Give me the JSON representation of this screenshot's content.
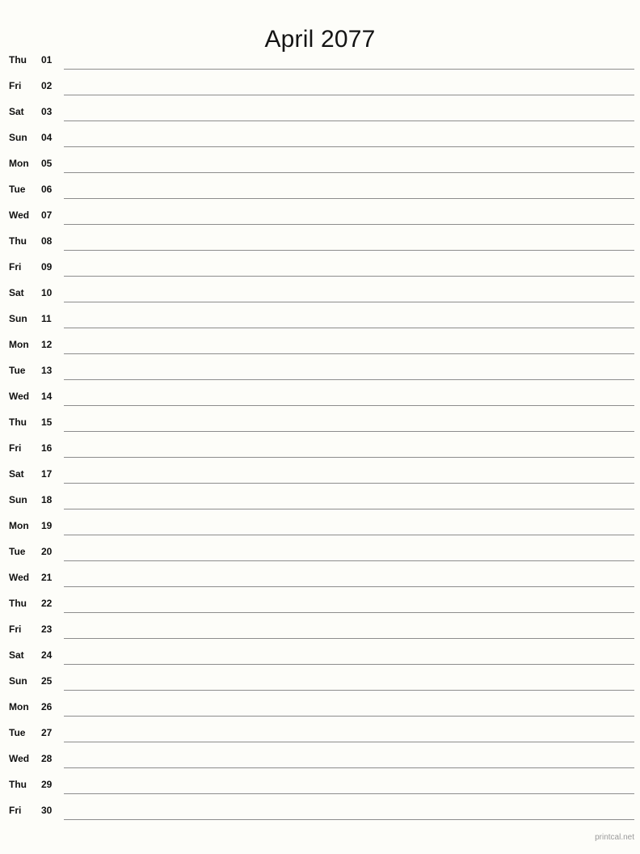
{
  "document": {
    "title": "April 2077",
    "month": "April",
    "year": "2077",
    "layout": "notes-list",
    "paper_background": "#fdfdf9",
    "line_color": "#8d8d8d",
    "text_color": "#141414"
  },
  "footer": {
    "label": "printcal.net"
  },
  "days": [
    {
      "weekday": "Thu",
      "date": "01"
    },
    {
      "weekday": "Fri",
      "date": "02"
    },
    {
      "weekday": "Sat",
      "date": "03"
    },
    {
      "weekday": "Sun",
      "date": "04"
    },
    {
      "weekday": "Mon",
      "date": "05"
    },
    {
      "weekday": "Tue",
      "date": "06"
    },
    {
      "weekday": "Wed",
      "date": "07"
    },
    {
      "weekday": "Thu",
      "date": "08"
    },
    {
      "weekday": "Fri",
      "date": "09"
    },
    {
      "weekday": "Sat",
      "date": "10"
    },
    {
      "weekday": "Sun",
      "date": "11"
    },
    {
      "weekday": "Mon",
      "date": "12"
    },
    {
      "weekday": "Tue",
      "date": "13"
    },
    {
      "weekday": "Wed",
      "date": "14"
    },
    {
      "weekday": "Thu",
      "date": "15"
    },
    {
      "weekday": "Fri",
      "date": "16"
    },
    {
      "weekday": "Sat",
      "date": "17"
    },
    {
      "weekday": "Sun",
      "date": "18"
    },
    {
      "weekday": "Mon",
      "date": "19"
    },
    {
      "weekday": "Tue",
      "date": "20"
    },
    {
      "weekday": "Wed",
      "date": "21"
    },
    {
      "weekday": "Thu",
      "date": "22"
    },
    {
      "weekday": "Fri",
      "date": "23"
    },
    {
      "weekday": "Sat",
      "date": "24"
    },
    {
      "weekday": "Sun",
      "date": "25"
    },
    {
      "weekday": "Mon",
      "date": "26"
    },
    {
      "weekday": "Tue",
      "date": "27"
    },
    {
      "weekday": "Wed",
      "date": "28"
    },
    {
      "weekday": "Thu",
      "date": "29"
    },
    {
      "weekday": "Fri",
      "date": "30"
    }
  ]
}
